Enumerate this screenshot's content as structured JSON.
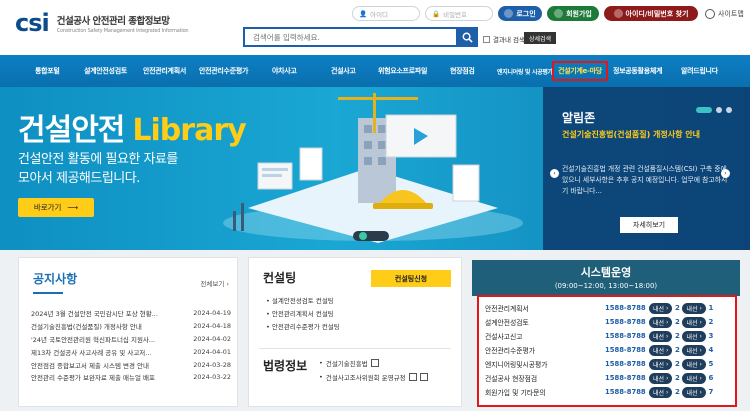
{
  "header": {
    "logo_mark": "csi",
    "logo_name": "건설공사 안전관리 종합정보망",
    "logo_sub": "Construction Safety Management Integrated Information",
    "id_placeholder": "아이디",
    "pw_placeholder": "비밀번호",
    "login_label": "로그인",
    "join_label": "회원가입",
    "find_label": "아이디/비밀번호 찾기",
    "sitemap_label": "사이트맵",
    "search_placeholder": "검색어를 입력하세요.",
    "in_result_label": "결과내 검색",
    "detail_search_label": "상세검색"
  },
  "nav": {
    "items": [
      {
        "label": "통합포털"
      },
      {
        "label": "설계안전성검토"
      },
      {
        "label": "안전관리계획서"
      },
      {
        "label": "안전관리수준평가"
      },
      {
        "label": "야차사고"
      },
      {
        "label": "건설사고"
      },
      {
        "label": "위험요소프로파일"
      },
      {
        "label": "현장점검"
      },
      {
        "label": "엔지니어링 및 시공평가"
      },
      {
        "label": "건설기계e-마당"
      },
      {
        "label": "정보공동활용체계"
      },
      {
        "label": "알려드립니다"
      }
    ]
  },
  "banner": {
    "title_main": "건설안전",
    "title_accent": "Library",
    "desc_line1": "건설안전 활동에 필요한 자료를",
    "desc_line2": "모아서 제공해드립니다.",
    "button_label": "바로가기"
  },
  "alert_zone": {
    "title": "알림존",
    "headline": "건설기술진흥법(건설품질) 개정사항 안내",
    "body": "건설기술진흥법 개정 관련 건설품질시스템(CSI) 구축 중에 있으니 세부사항은 추후 공지 예정입니다. 업무에 참고하시기 바랍니다...",
    "button_label": "자세히보기"
  },
  "notices": {
    "title": "공지사항",
    "more_label": "전체보기",
    "items": [
      {
        "title": "2024년 3월 건설안전 국민감시단 포상 현황...",
        "date": "2024-04-19"
      },
      {
        "title": "건설기술진흥법(건설품질) 개정사항 안내",
        "date": "2024-04-18"
      },
      {
        "title": "'24년 국토안전관리원 혁신파트너십 지원사...",
        "date": "2024-04-02"
      },
      {
        "title": "제13차 건설공사 사고사례 공유 및 사고저...",
        "date": "2024-04-01"
      },
      {
        "title": "안전점검 종합보고서 제출 시스템 변경 안내",
        "date": "2024-03-28"
      },
      {
        "title": "안전관리 수준평가 보완자료 제출 매뉴얼 배포",
        "date": "2024-03-22"
      }
    ]
  },
  "consulting": {
    "title": "컨설팅",
    "apply_label": "컨설팅신청",
    "items": [
      {
        "label": "설계안전성검토 컨설팅"
      },
      {
        "label": "안전관리계획서 컨설팅"
      },
      {
        "label": "안전관리수준평가 컨설팅"
      }
    ]
  },
  "laws": {
    "title": "법령정보",
    "items": [
      {
        "label": "건설기술진흥법"
      },
      {
        "label": "건설사고조사위원회 운영규정"
      }
    ]
  },
  "system": {
    "title": "시스템운영",
    "hours": "(09:00~12:00, 13:00~18:00)",
    "ext_label": "내선",
    "rows": [
      {
        "name": "안전관리계획서",
        "phone": "1588-8788",
        "ext1": "2",
        "ext2": "1"
      },
      {
        "name": "설계안전성검토",
        "phone": "1588-8788",
        "ext1": "2",
        "ext2": "2"
      },
      {
        "name": "건설사고신고",
        "phone": "1588-8788",
        "ext1": "2",
        "ext2": "3"
      },
      {
        "name": "안전관리수준평가",
        "phone": "1588-8788",
        "ext1": "2",
        "ext2": "4"
      },
      {
        "name": "엔지니어링및시공평가",
        "phone": "1588-8788",
        "ext1": "2",
        "ext2": "5"
      },
      {
        "name": "건설공사 현장점검",
        "phone": "1588-8788",
        "ext1": "2",
        "ext2": "6"
      },
      {
        "name": "회원가입 및 기타문의",
        "phone": "1588-8788",
        "ext1": "2",
        "ext2": "7"
      }
    ]
  },
  "colors": {
    "primary": "#1d5fa8",
    "nav": "#0d7fc4",
    "accent_yellow": "#ffcc18",
    "highlight_red": "#e01818"
  }
}
